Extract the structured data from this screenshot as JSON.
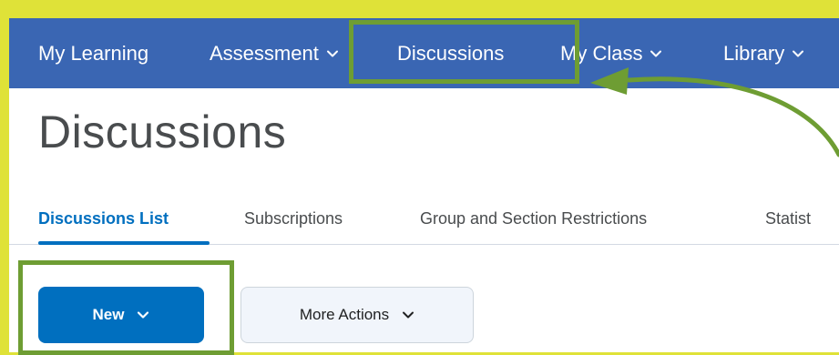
{
  "nav": {
    "items": [
      {
        "label": "My Learning",
        "has_dropdown": false
      },
      {
        "label": "Assessment",
        "has_dropdown": true
      },
      {
        "label": "Discussions",
        "has_dropdown": false
      },
      {
        "label": "My Class",
        "has_dropdown": true
      },
      {
        "label": "Library",
        "has_dropdown": true
      }
    ]
  },
  "page": {
    "title": "Discussions"
  },
  "tabs": [
    {
      "label": "Discussions List",
      "active": true
    },
    {
      "label": "Subscriptions",
      "active": false
    },
    {
      "label": "Group and Section Restrictions",
      "active": false
    },
    {
      "label": "Statist",
      "active": false
    }
  ],
  "actions": {
    "new_label": "New",
    "more_actions_label": "More Actions"
  },
  "colors": {
    "background": "#dfe238",
    "navbar": "#3a66b3",
    "primary": "#006fbf",
    "highlight": "#6e9d33"
  },
  "icons": {
    "dropdown": "chevron-down-icon",
    "annotation_arrow": "curved-arrow-icon"
  }
}
